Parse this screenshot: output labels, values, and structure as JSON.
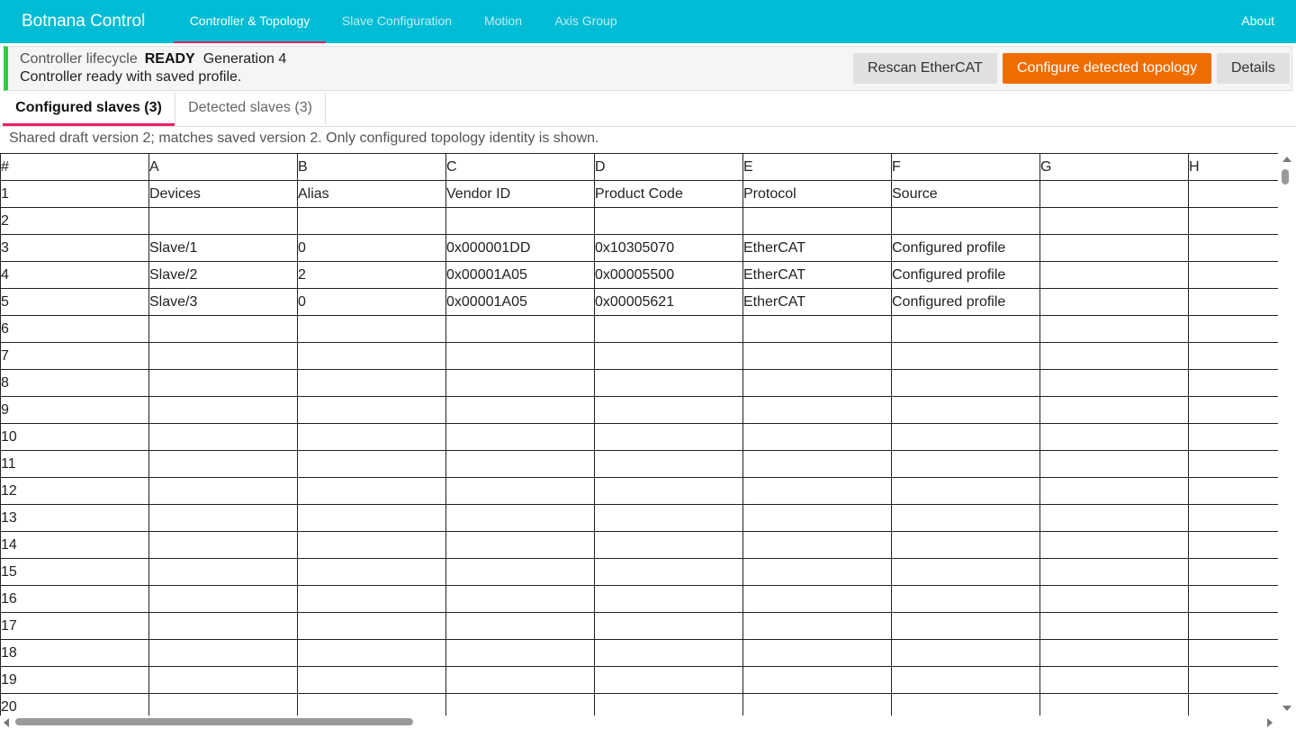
{
  "app": {
    "brand": "Botnana Control",
    "nav_tabs": [
      {
        "label": "Controller & Topology",
        "active": true
      },
      {
        "label": "Slave Configuration",
        "active": false
      },
      {
        "label": "Motion",
        "active": false
      },
      {
        "label": "Axis Group",
        "active": false
      }
    ],
    "about_label": "About",
    "accent_color": "#00bcd4",
    "active_indicator_color": "#e91e63"
  },
  "status": {
    "lifecycle_label": "Controller lifecycle",
    "state": "READY",
    "generation": "Generation 4",
    "message": "Controller ready with saved profile.",
    "indicator_color": "#2ecc40",
    "buttons": {
      "rescan": "Rescan EtherCAT",
      "configure": "Configure detected topology",
      "details": "Details"
    }
  },
  "tabs": [
    {
      "label": "Configured slaves (3)",
      "active": true
    },
    {
      "label": "Detected slaves (3)",
      "active": false
    }
  ],
  "note": "Shared draft version 2; matches saved version 2. Only configured topology identity is shown.",
  "sheet": {
    "column_headers": [
      "#",
      "A",
      "B",
      "C",
      "D",
      "E",
      "F",
      "G",
      "H"
    ],
    "rows": [
      [
        "1",
        "Devices",
        "Alias",
        "Vendor ID",
        "Product Code",
        "Protocol",
        "Source",
        "",
        ""
      ],
      [
        "2",
        "",
        "",
        "",
        "",
        "",
        "",
        "",
        ""
      ],
      [
        "3",
        "Slave/1",
        "0",
        "0x000001DD",
        "0x10305070",
        "EtherCAT",
        "Configured profile",
        "",
        ""
      ],
      [
        "4",
        "Slave/2",
        "2",
        "0x00001A05",
        "0x00005500",
        "EtherCAT",
        "Configured profile",
        "",
        ""
      ],
      [
        "5",
        "Slave/3",
        "0",
        "0x00001A05",
        "0x00005621",
        "EtherCAT",
        "Configured profile",
        "",
        ""
      ],
      [
        "6",
        "",
        "",
        "",
        "",
        "",
        "",
        "",
        ""
      ],
      [
        "7",
        "",
        "",
        "",
        "",
        "",
        "",
        "",
        ""
      ],
      [
        "8",
        "",
        "",
        "",
        "",
        "",
        "",
        "",
        ""
      ],
      [
        "9",
        "",
        "",
        "",
        "",
        "",
        "",
        "",
        ""
      ],
      [
        "10",
        "",
        "",
        "",
        "",
        "",
        "",
        "",
        ""
      ],
      [
        "11",
        "",
        "",
        "",
        "",
        "",
        "",
        "",
        ""
      ],
      [
        "12",
        "",
        "",
        "",
        "",
        "",
        "",
        "",
        ""
      ],
      [
        "13",
        "",
        "",
        "",
        "",
        "",
        "",
        "",
        ""
      ],
      [
        "14",
        "",
        "",
        "",
        "",
        "",
        "",
        "",
        ""
      ],
      [
        "15",
        "",
        "",
        "",
        "",
        "",
        "",
        "",
        ""
      ],
      [
        "16",
        "",
        "",
        "",
        "",
        "",
        "",
        "",
        ""
      ],
      [
        "17",
        "",
        "",
        "",
        "",
        "",
        "",
        "",
        ""
      ],
      [
        "18",
        "",
        "",
        "",
        "",
        "",
        "",
        "",
        ""
      ],
      [
        "19",
        "",
        "",
        "",
        "",
        "",
        "",
        "",
        ""
      ],
      [
        "20",
        "",
        "",
        "",
        "",
        "",
        "",
        "",
        ""
      ]
    ]
  }
}
